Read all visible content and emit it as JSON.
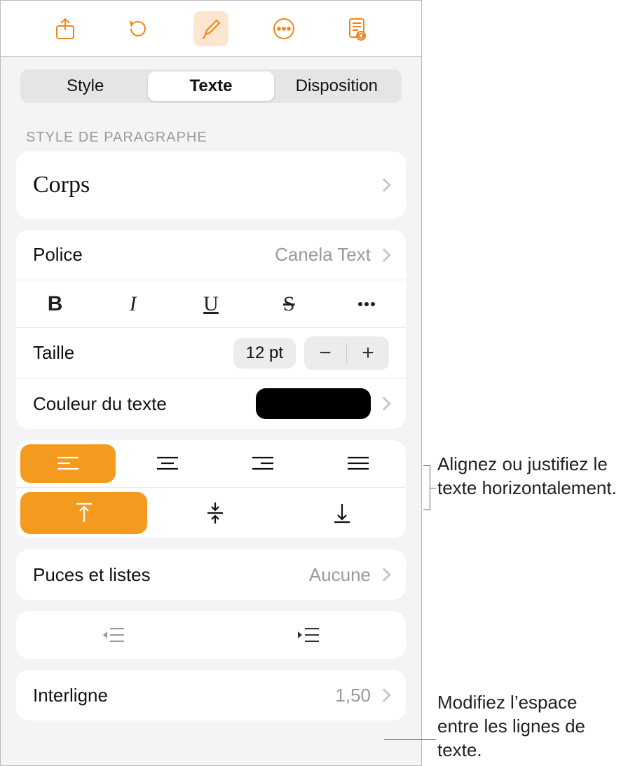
{
  "toolbar": {
    "icons": [
      "share-icon",
      "undo-icon",
      "format-brush-icon",
      "more-icon",
      "document-view-icon"
    ]
  },
  "tabs": {
    "items": [
      "Style",
      "Texte",
      "Disposition"
    ],
    "active": 1
  },
  "section_paragraph_style_label": "STYLE DE PARAGRAPHE",
  "paragraph_style": {
    "value": "Corps"
  },
  "font": {
    "label": "Police",
    "value": "Canela Text"
  },
  "format_buttons": {
    "bold": "B",
    "italic": "I",
    "underline": "U",
    "strike": "S"
  },
  "size": {
    "label": "Taille",
    "value": "12 pt",
    "minus": "−",
    "plus": "+"
  },
  "text_color": {
    "label": "Couleur du texte",
    "swatch": "#000000"
  },
  "alignment": {
    "active_h": 0,
    "active_v": 0
  },
  "bullets": {
    "label": "Puces et listes",
    "value": "Aucune"
  },
  "line_spacing": {
    "label": "Interligne",
    "value": "1,50"
  },
  "callouts": {
    "align": "Alignez ou justifiez le texte horizontalement.",
    "spacing": "Modifiez l’espace entre les lignes de texte."
  }
}
